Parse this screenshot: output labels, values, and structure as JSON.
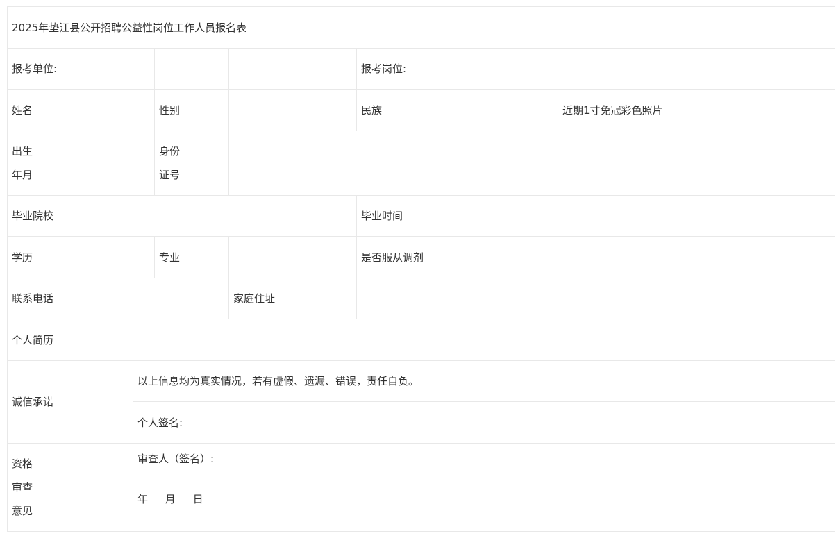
{
  "title": "2025年垫江县公开招聘公益性岗位工作人员报名表",
  "labels": {
    "unit": "报考单位:",
    "position": "报考岗位:",
    "name": "姓名",
    "gender": "性别",
    "ethnicity": "民族",
    "photo": "近期1寸免冠彩色照片",
    "birth_line1": "出生",
    "birth_line2": "年月",
    "id_line1": "身份",
    "id_line2": "证号",
    "school": "毕业院校",
    "grad_time": "毕业时间",
    "education": "学历",
    "major": "专业",
    "accept_adjust": "是否服从调剂",
    "phone": "联系电话",
    "address": "家庭住址",
    "resume": "个人简历",
    "integrity": "诚信承诺",
    "integrity_statement": "以上信息均为真实情况，若有虚假、遗漏、错误，责任自负。",
    "personal_signature": "个人签名:",
    "review_line1": "资格",
    "review_line2": "审查",
    "review_line3": "意见",
    "reviewer_signature": "审查人（签名）:",
    "date_year": "年",
    "date_month": "月",
    "date_day": "日"
  }
}
